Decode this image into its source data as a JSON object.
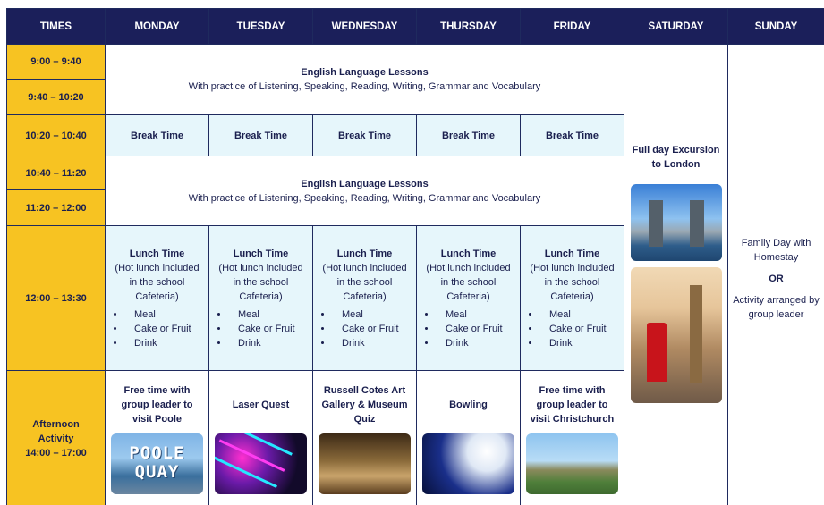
{
  "headers": [
    "TIMES",
    "MONDAY",
    "TUESDAY",
    "WEDNESDAY",
    "THURSDAY",
    "FRIDAY",
    "SATURDAY",
    "SUNDAY"
  ],
  "times": [
    "9:00 – 9:40",
    "9:40 – 10:20",
    "10:20 – 10:40",
    "10:40 – 11:20",
    "11:20 – 12:00",
    "12:00 – 13:30"
  ],
  "afternoon_time": {
    "label1": "Afternoon",
    "label2": "Activity",
    "range": "14:00 – 17:00"
  },
  "lesson": {
    "title": "English Language Lessons",
    "desc": "With practice of Listening, Speaking, Reading, Writing, Grammar and Vocabulary"
  },
  "break_label": "Break Time",
  "lunch": {
    "title": "Lunch Time",
    "line1": "(Hot lunch included",
    "line2": "in the school",
    "line3": "Cafeteria)",
    "items": [
      "Meal",
      "Cake or Fruit",
      "Drink"
    ]
  },
  "activities": [
    {
      "line1": "Free time with",
      "line2": "group leader to",
      "line3": "visit Poole",
      "pic": "poole-quay-photo",
      "pic_text1": "POOLE",
      "pic_text2": "QUAY"
    },
    {
      "line1": "Laser Quest",
      "line2": "",
      "line3": "",
      "pic": "laser-quest-photo"
    },
    {
      "line1": "Russell Cotes Art",
      "line2": "Gallery & Museum",
      "line3": "Quiz",
      "pic": "gallery-photo"
    },
    {
      "line1": "Bowling",
      "line2": "",
      "line3": "",
      "pic": "bowling-photo"
    },
    {
      "line1": "Free time with",
      "line2": "group leader to",
      "line3": "visit Christchurch",
      "pic": "christchurch-photo"
    }
  ],
  "saturday": {
    "line1": "Full day Excursion",
    "line2": "to London"
  },
  "sunday": {
    "line1": "Family Day with",
    "line2": "Homestay",
    "or": "OR",
    "line3": "Activity arranged by",
    "line4": "group leader"
  },
  "colors": {
    "header": "#1b1f5a",
    "time": "#f7c322",
    "light": "#e6f6fb"
  }
}
